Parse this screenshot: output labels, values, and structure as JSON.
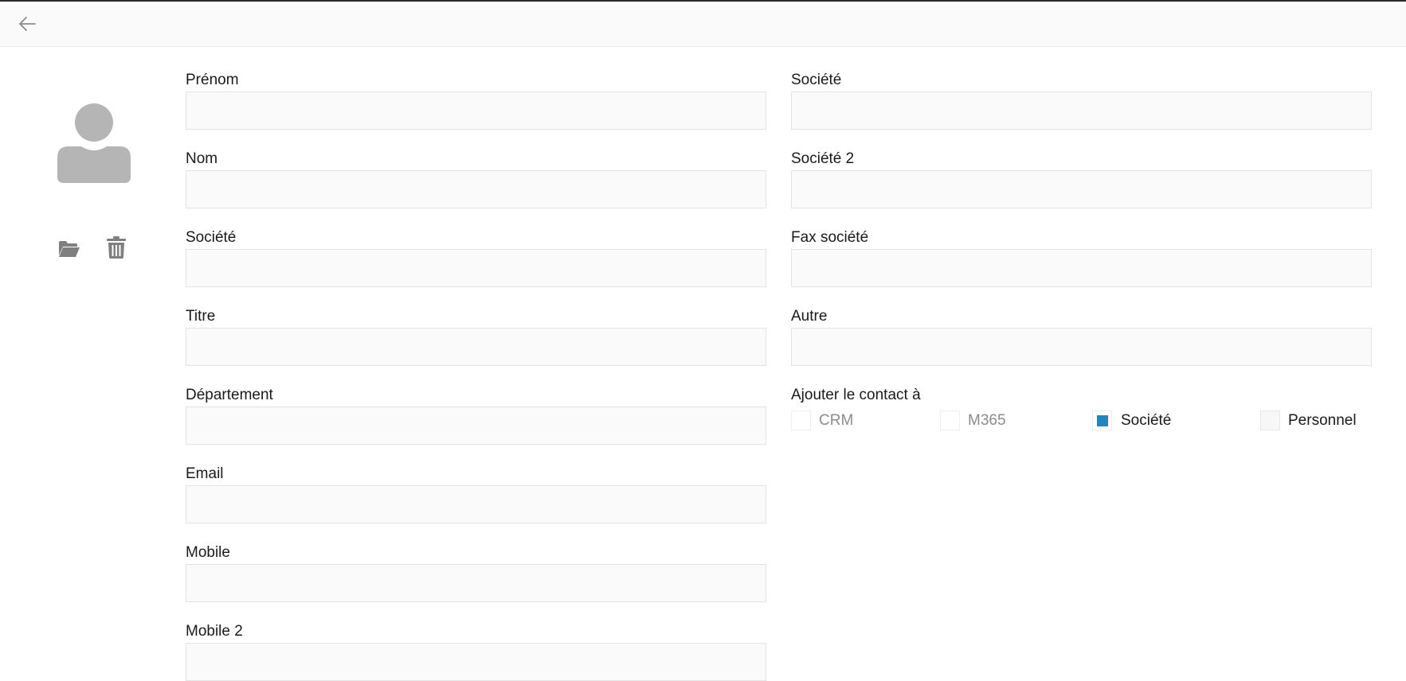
{
  "header": {
    "back_icon": "arrow-left-icon"
  },
  "sidebar": {
    "avatar_icon": "user-avatar-icon",
    "open_icon": "folder-open-icon",
    "delete_icon": "trash-icon"
  },
  "form": {
    "left": [
      {
        "label": "Prénom",
        "value": ""
      },
      {
        "label": "Nom",
        "value": ""
      },
      {
        "label": "Société",
        "value": ""
      },
      {
        "label": "Titre",
        "value": ""
      },
      {
        "label": "Département",
        "value": ""
      },
      {
        "label": "Email",
        "value": ""
      },
      {
        "label": "Mobile",
        "value": ""
      },
      {
        "label": "Mobile 2",
        "value": ""
      }
    ],
    "right": [
      {
        "label": "Société",
        "value": ""
      },
      {
        "label": "Société 2",
        "value": ""
      },
      {
        "label": "Fax société",
        "value": ""
      },
      {
        "label": "Autre",
        "value": ""
      }
    ],
    "add_contact": {
      "label": "Ajouter le contact à",
      "options": [
        {
          "label": "CRM",
          "checked": false,
          "disabled": true
        },
        {
          "label": "M365",
          "checked": false,
          "disabled": true
        },
        {
          "label": "Société",
          "checked": true,
          "disabled": false
        },
        {
          "label": "Personnel",
          "checked": false,
          "disabled": false
        }
      ]
    }
  },
  "colors": {
    "accent": "#1a87c9",
    "field_bg": "#fafafa",
    "field_border": "#e3e3e3",
    "icon_gray": "#808080",
    "avatar_gray": "#b5b5b5"
  }
}
